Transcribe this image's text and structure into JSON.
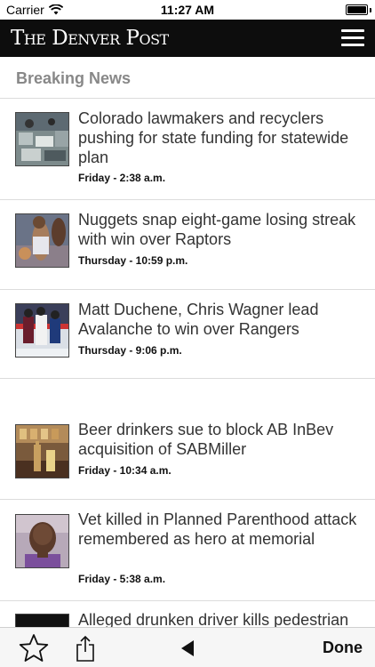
{
  "status_bar": {
    "carrier": "Carrier",
    "time": "11:27 AM"
  },
  "masthead": {
    "title": "The Denver Post"
  },
  "section": {
    "title": "Breaking News"
  },
  "stories": [
    {
      "headline": "Colorado lawmakers and recyclers pushing for state funding for statewide plan",
      "time": "Friday - 2:38 a.m.",
      "thumb_icon": "recycling-photo"
    },
    {
      "headline": "Nuggets snap eight-game losing streak with win over Raptors",
      "time": "Thursday - 10:59 p.m.",
      "thumb_icon": "basketball-photo"
    },
    {
      "headline": "Matt Duchene, Chris Wagner lead Avalanche to win over Rangers",
      "time": "Thursday - 9:06 p.m.",
      "thumb_icon": "hockey-photo"
    },
    {
      "headline": "Beer drinkers sue to block AB InBev acquisition of SABMiller",
      "time": "Friday - 10:34 a.m.",
      "thumb_icon": "beer-photo"
    },
    {
      "headline": "Vet killed in Planned Parenthood attack remembered as hero at memorial",
      "time": "Friday - 5:38 a.m.",
      "thumb_icon": "portrait-photo"
    },
    {
      "headline": "Alleged drunken driver kills pedestrian",
      "time": "",
      "thumb_icon": "dark-photo"
    }
  ],
  "toolbar": {
    "done_label": "Done",
    "star_icon": "star-icon",
    "share_icon": "share-icon",
    "back_icon": "back-arrow-icon"
  }
}
